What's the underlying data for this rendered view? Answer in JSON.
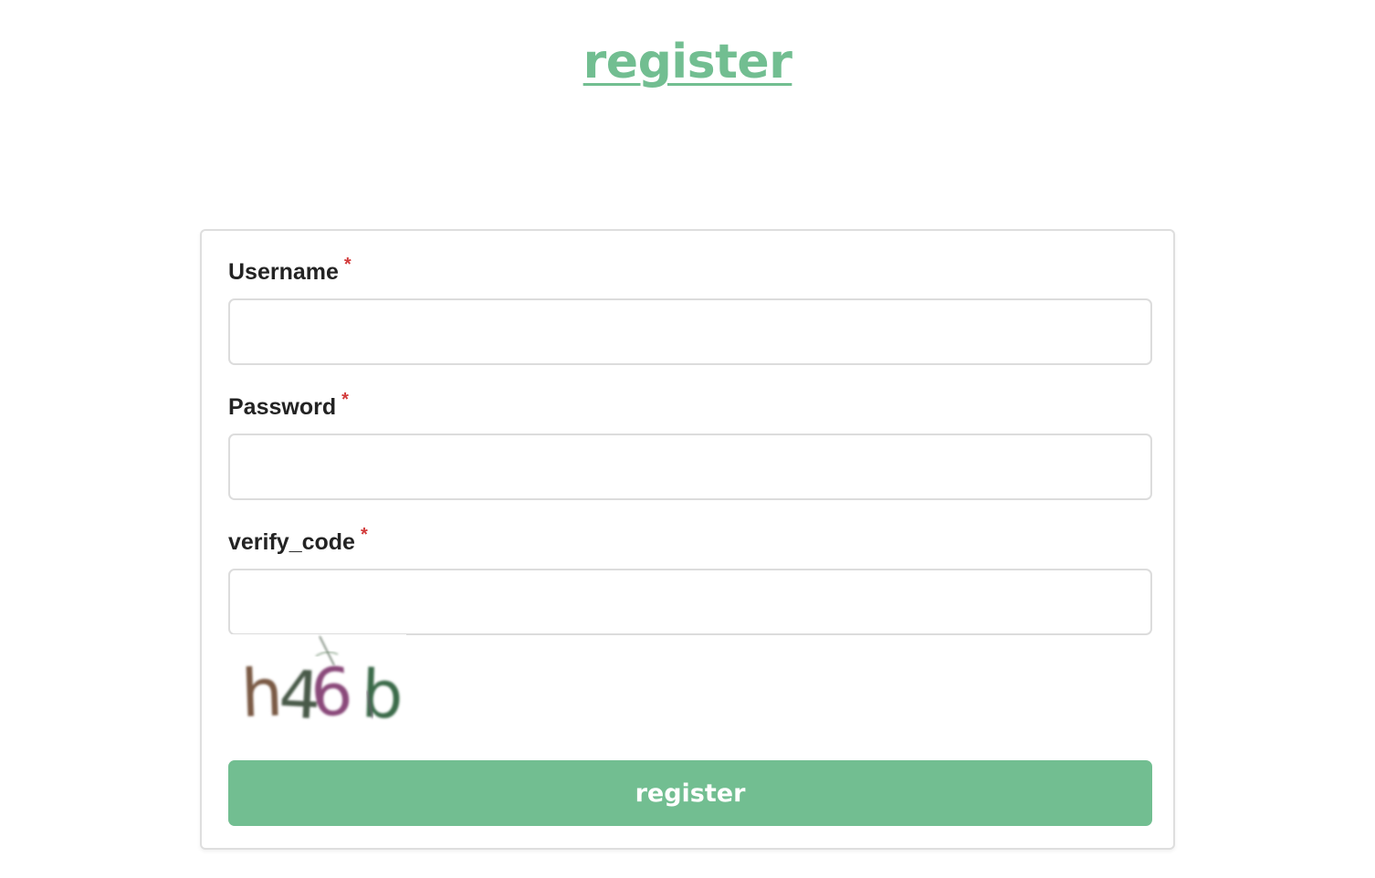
{
  "header": {
    "title": "register"
  },
  "form": {
    "fields": [
      {
        "label": "Username",
        "required_mark": "*",
        "value": "",
        "placeholder": ""
      },
      {
        "label": "Password",
        "required_mark": "*",
        "value": "",
        "placeholder": ""
      },
      {
        "label": "verify_code",
        "required_mark": "*",
        "value": "",
        "placeholder": ""
      }
    ],
    "captcha": {
      "text": "h46b",
      "char_colors": [
        "#7a5a45",
        "#4a5a4a",
        "#8a4a7a",
        "#3a6a4a"
      ]
    },
    "submit_label": "register"
  },
  "colors": {
    "accent": "#72be91",
    "required": "#d23a3a",
    "border": "#dcdcdc"
  }
}
